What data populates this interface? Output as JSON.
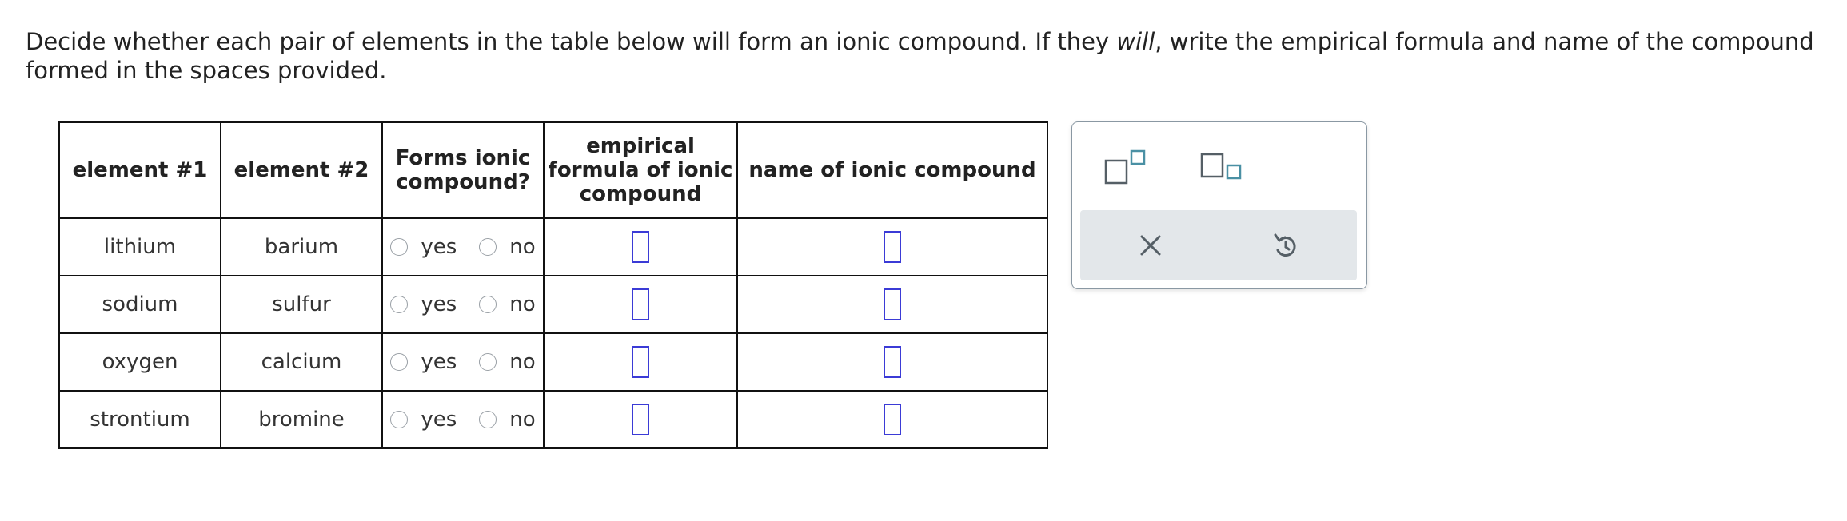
{
  "prompt": {
    "part1": "Decide whether each pair of elements in the table below will form an ionic compound. If they ",
    "emphasis": "will",
    "part2": ", write the empirical formula and name of the compound formed in the spaces provided."
  },
  "table": {
    "headers": {
      "element1": "element #1",
      "element2": "element #2",
      "forms_line1": "Forms ionic",
      "forms_line2": "compound?",
      "formula_line1": "empirical",
      "formula_line2": "formula of ionic",
      "formula_line3": "compound",
      "name": "name of ionic compound"
    },
    "yes_label": "yes",
    "no_label": "no",
    "rows": [
      {
        "element1": "lithium",
        "element2": "barium"
      },
      {
        "element1": "sodium",
        "element2": "sulfur"
      },
      {
        "element1": "oxygen",
        "element2": "calcium"
      },
      {
        "element1": "strontium",
        "element2": "bromine"
      }
    ]
  },
  "palette": {
    "icons": [
      "superscript-icon",
      "subscript-icon",
      "clear-icon",
      "undo-icon"
    ],
    "accent_color": "#4a90a4",
    "icon_color": "#555f66"
  }
}
